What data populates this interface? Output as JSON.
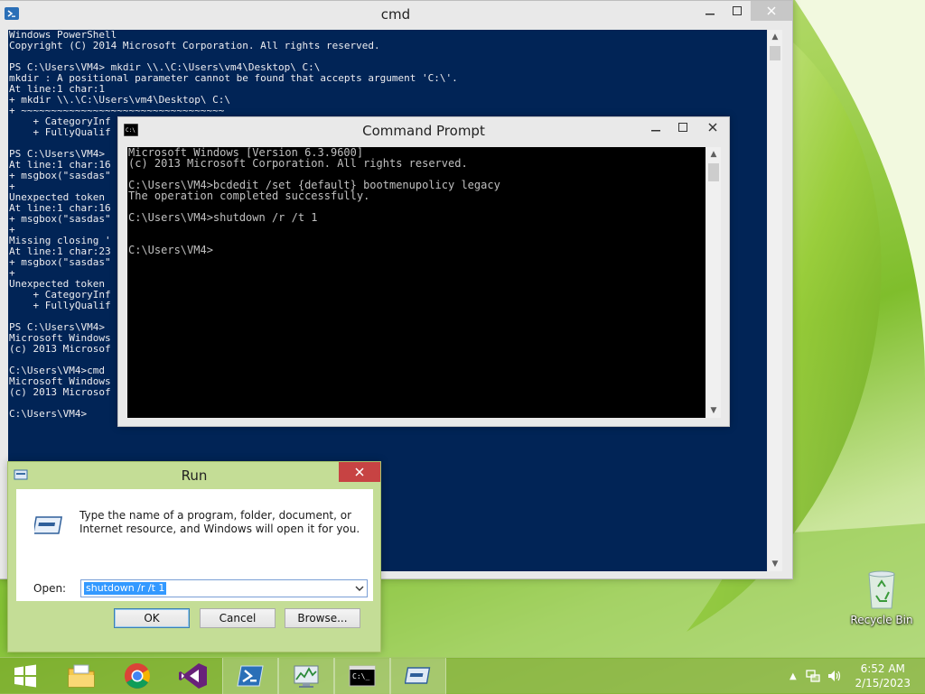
{
  "powershell": {
    "title": "cmd",
    "lines": "Windows PowerShell\nCopyright (C) 2014 Microsoft Corporation. All rights reserved.\n\nPS C:\\Users\\VM4> mkdir \\\\.\\C:\\Users\\vm4\\Desktop\\ C:\\\nmkdir : A positional parameter cannot be found that accepts argument 'C:\\'.\nAt line:1 char:1\n+ mkdir \\\\.\\C:\\Users\\vm4\\Desktop\\ C:\\\n+ ~~~~~~~~~~~~~~~~~~~~~~~~~~~~~~~~~~\n    + CategoryInf\n    + FullyQualif\n\nPS C:\\Users\\VM4>\nAt line:1 char:16\n+ msgbox(\"sasdas\"\n+\nUnexpected token\nAt line:1 char:16\n+ msgbox(\"sasdas\"\n+\nMissing closing '\nAt line:1 char:23\n+ msgbox(\"sasdas\"\n+\nUnexpected token\n    + CategoryInf\n    + FullyQualif\n\nPS C:\\Users\\VM4>\nMicrosoft Windows\n(c) 2013 Microsof\n\nC:\\Users\\VM4>cmd\nMicrosoft Windows\n(c) 2013 Microsof\n\nC:\\Users\\VM4>"
  },
  "cmd": {
    "title": "Command Prompt",
    "lines": "Microsoft Windows [Version 6.3.9600]\n(c) 2013 Microsoft Corporation. All rights reserved.\n\nC:\\Users\\VM4>bcdedit /set {default} bootmenupolicy legacy\nThe operation completed successfully.\n\nC:\\Users\\VM4>shutdown /r /t 1\n\n\nC:\\Users\\VM4>"
  },
  "run": {
    "title": "Run",
    "description": "Type the name of a program, folder, document, or Internet resource, and Windows will open it for you.",
    "open_label": "Open:",
    "input_value": "shutdown /r /t 1",
    "ok_label": "OK",
    "cancel_label": "Cancel",
    "browse_label": "Browse..."
  },
  "desktop": {
    "recycle_bin_label": "Recycle Bin"
  },
  "taskbar": {
    "items": [
      "start-icon",
      "file-explorer-icon",
      "chrome-icon",
      "visual-studio-icon",
      "powershell-icon",
      "performance-monitor-icon",
      "command-prompt-icon",
      "run-icon"
    ],
    "time": "6:52 AM",
    "date": "2/15/2023"
  }
}
